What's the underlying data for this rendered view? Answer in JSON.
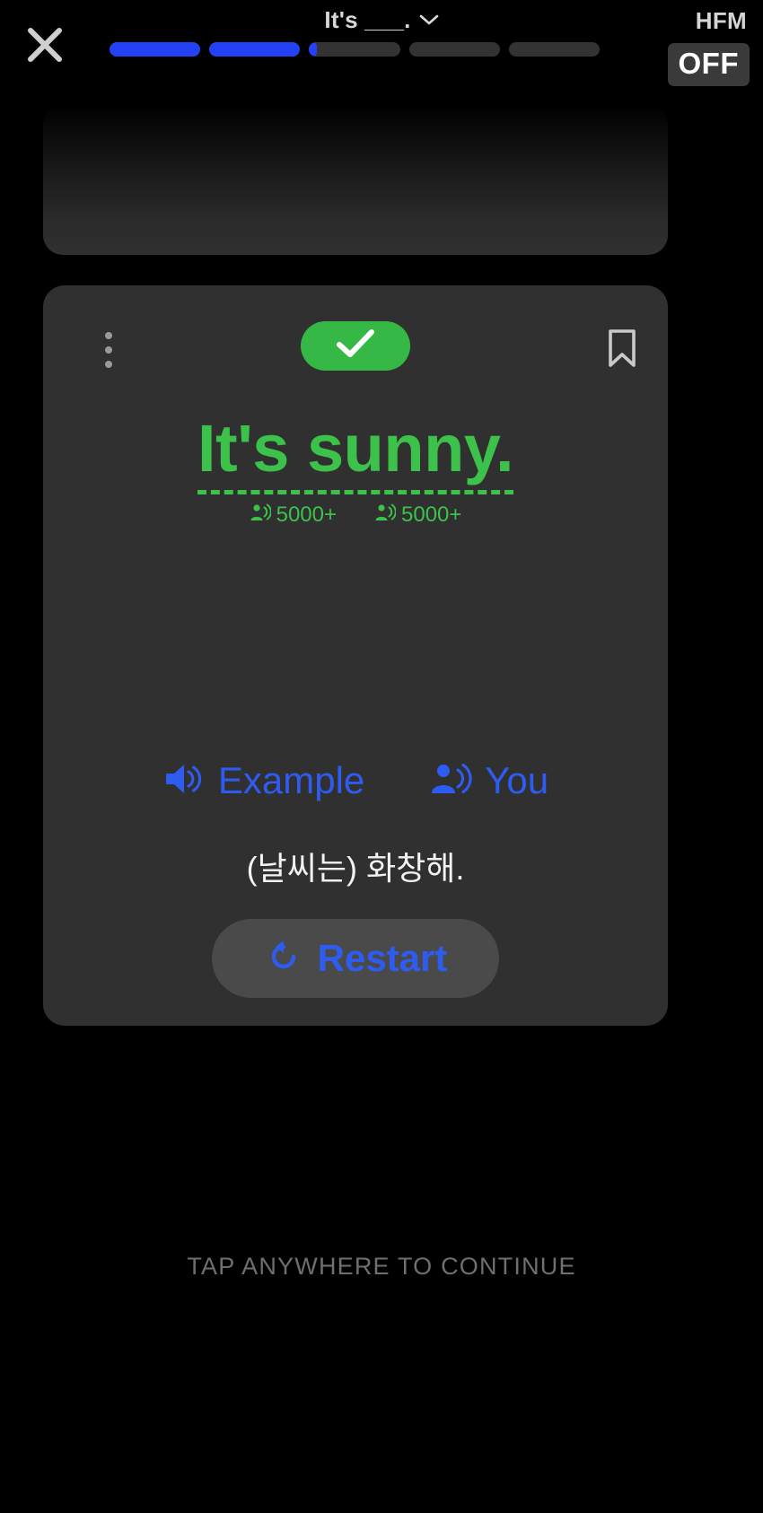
{
  "header": {
    "close_icon": "close-x-icon",
    "title": "It's ___.",
    "dropdown_icon": "chevron-down-icon",
    "hfm_label": "HFM",
    "hfm_state": "OFF",
    "progress": {
      "total_segments": 5,
      "fills": [
        100,
        100,
        8,
        0,
        0
      ],
      "fill_color": "#2342f5",
      "track_color": "#333333"
    }
  },
  "card_previous": {
    "visible": true,
    "gradient_from": "#000000",
    "gradient_to": "#303030"
  },
  "card_main": {
    "background": "#303030",
    "menu_icon": "more-vertical-icon",
    "status_pill": {
      "icon": "check-icon",
      "color": "#35b845",
      "state": "correct"
    },
    "bookmark_icon": "bookmark-outline-icon",
    "answer": {
      "text": "It's sunny.",
      "color": "#3cc14b",
      "underline": "dashed"
    },
    "usage_chips": [
      {
        "icon": "person-speaking-icon",
        "label": "5000+"
      },
      {
        "icon": "person-speaking-icon",
        "label": "5000+"
      }
    ],
    "audio_buttons": [
      {
        "icon": "speaker-icon",
        "label": "Example",
        "color": "#2f5cf0"
      },
      {
        "icon": "person-speaking-icon",
        "label": "You",
        "color": "#2f5cf0"
      }
    ],
    "translation": "(날씨는) 화창해.",
    "restart": {
      "icon": "restart-rotate-icon",
      "label": "Restart",
      "color": "#2f5cf0",
      "background": "#4a4a4a"
    }
  },
  "footer": {
    "tap_hint": "TAP ANYWHERE TO CONTINUE",
    "color": "#6f6f6f"
  }
}
